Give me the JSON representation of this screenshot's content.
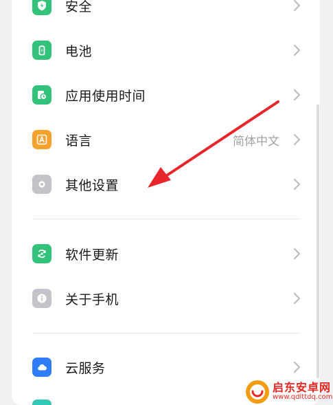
{
  "settings": {
    "items": [
      {
        "label": "安全",
        "icon": "shield-icon",
        "color": "#33c27a"
      },
      {
        "label": "电池",
        "icon": "battery-icon",
        "color": "#33c27a"
      },
      {
        "label": "应用使用时间",
        "icon": "app-usage-icon",
        "color": "#33c27a"
      },
      {
        "label": "语言",
        "value": "简体中文",
        "icon": "language-icon",
        "color": "#f7a22c"
      },
      {
        "label": "其他设置",
        "icon": "other-settings-icon",
        "color": "#c2c4c9"
      },
      {
        "label": "软件更新",
        "icon": "software-update-icon",
        "color": "#33c27a"
      },
      {
        "label": "关于手机",
        "icon": "info-icon",
        "color": "#c2c4c9"
      },
      {
        "label": "云服务",
        "icon": "cloud-icon",
        "color": "#2f7ef5"
      }
    ]
  },
  "watermark": {
    "title": "启东安卓网",
    "url": "www.qdlttdq.com"
  },
  "annotation": {
    "color": "#e8262c"
  }
}
